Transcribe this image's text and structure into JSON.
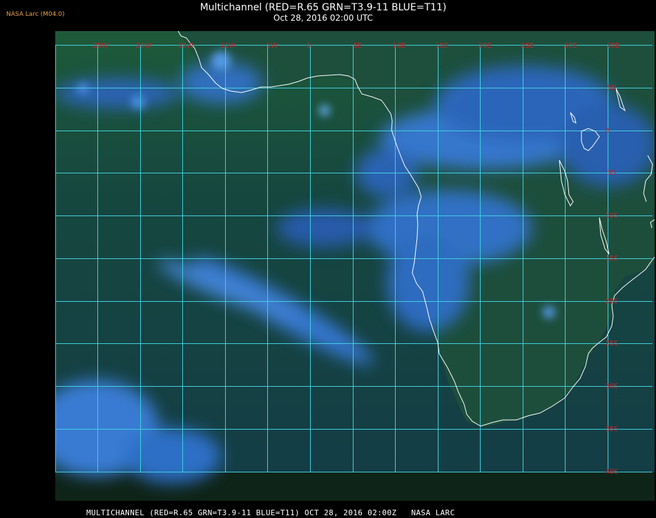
{
  "source": "NASA Larc (M04.0)",
  "title": "Multichannel (RED=R.65 GRN=T3.9-11 BLUE=T11)",
  "subtitle": "Oct 28, 2016 02:00 UTC",
  "footer": "MULTICHANNEL (RED=R.65 GRN=T3.9-11 BLUE=T11) OCT 28, 2016 02:00Z   NASA LARC",
  "colors": {
    "background": "#000000",
    "grid": "#40d0e0",
    "grid_label": "#c0272d",
    "coastline": "#ffffff",
    "ocean": "#163e48",
    "land": "#1c5530",
    "cloud": "#3a7ee6"
  },
  "map": {
    "lon_labels": [
      "25W",
      "20W",
      "15W",
      "10W",
      "5W",
      "0",
      "5E",
      "10E",
      "15E",
      "20E",
      "25E",
      "30E",
      "35E"
    ],
    "lat_labels": [
      "5N",
      "0",
      "5S",
      "10S",
      "15S",
      "20S",
      "25S",
      "30S",
      "35S",
      "40S"
    ],
    "top_lat_label": "10N"
  }
}
